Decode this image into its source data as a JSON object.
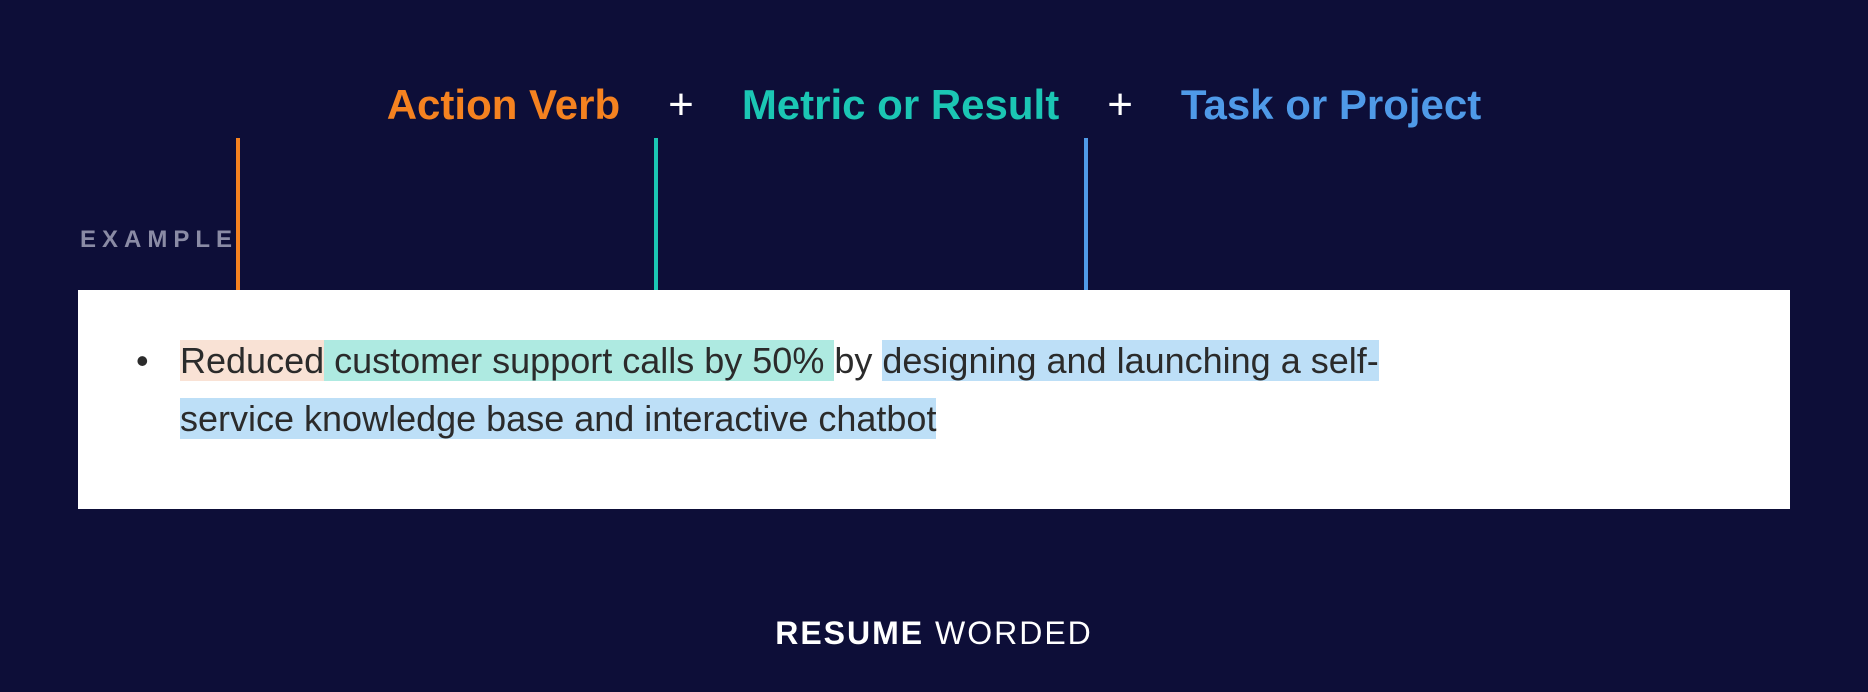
{
  "formula": {
    "action_verb_label": "Action Verb",
    "plus": "+",
    "metric_label": "Metric or Result",
    "task_label": "Task or Project"
  },
  "example_label": "EXAMPLE",
  "example": {
    "bullet": "•",
    "action_verb": "Reduced",
    "metric_part": " customer support calls by 50% ",
    "connector": "by ",
    "task_part_1": "designing and launching a self-",
    "task_part_2": "service knowledge base and interactive chatbot"
  },
  "brand": {
    "first": "RESUME",
    "second": " WORDED"
  },
  "colors": {
    "action": "#f58220",
    "metric": "#1bc6b4",
    "task": "#4f9ae8",
    "bg": "#0d0e38"
  }
}
